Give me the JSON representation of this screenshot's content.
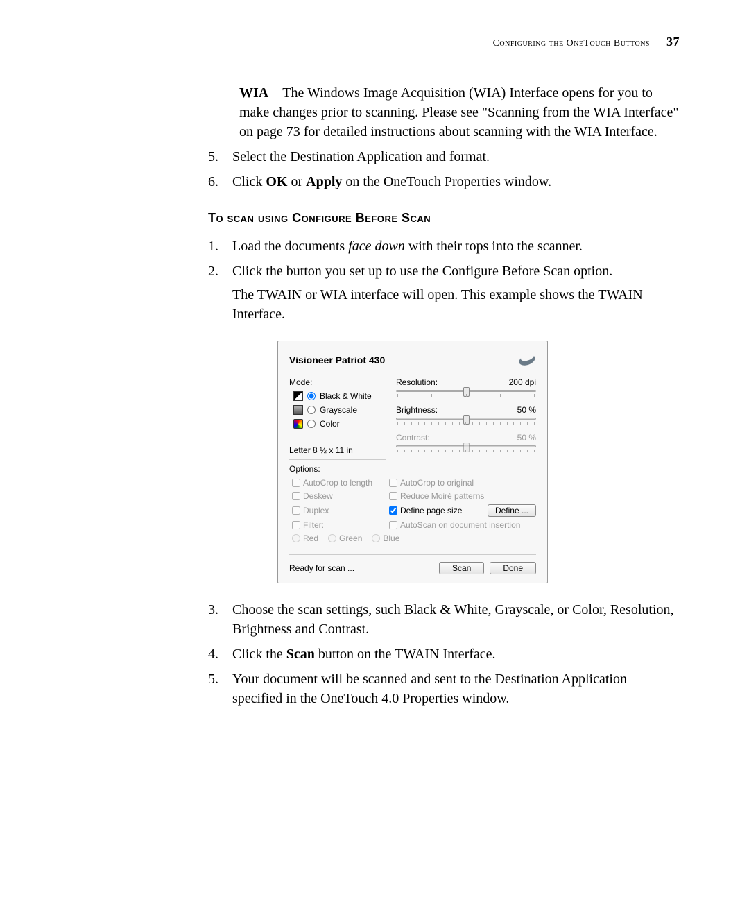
{
  "header": {
    "running_head": "Configuring the OneTouch Buttons",
    "page_number": "37"
  },
  "body": {
    "wia_desc_prefix": "WIA",
    "wia_desc": "—The Windows Image Acquisition (WIA) Interface opens for you to make changes prior to scanning. Please see \"Scanning from the WIA Interface\" on page 73 for detailed instructions about scanning with the WIA Interface.",
    "pre_list": [
      {
        "num": "5.",
        "text": "Select the Destination Application and format."
      },
      {
        "num": "6.",
        "pre": "Click ",
        "b1": "OK",
        "mid": " or ",
        "b2": "Apply",
        "post": " on the OneTouch Properties window."
      }
    ],
    "subheading": "To scan using Configure Before Scan",
    "steps": [
      {
        "num": "1.",
        "pre": "Load the documents ",
        "i": "face down",
        "post": " with their tops into the scanner."
      },
      {
        "num": "2.",
        "text": "Click the button you set up to use the Configure Before Scan option.",
        "sub": "The TWAIN or WIA interface will open. This example shows the TWAIN Interface."
      }
    ],
    "post_steps": [
      {
        "num": "3.",
        "text": "Choose the scan settings, such Black & White, Grayscale, or Color, Resolution, Brightness and Contrast."
      },
      {
        "num": "4.",
        "pre": "Click the ",
        "b1": "Scan",
        "post": " button on the TWAIN Interface."
      },
      {
        "num": "5.",
        "text": "Your document will be scanned and sent to the Destination Application specified in the OneTouch 4.0 Properties window."
      }
    ]
  },
  "dialog": {
    "title": "Visioneer Patriot 430",
    "mode_label": "Mode:",
    "modes": {
      "bw": "Black & White",
      "gray": "Grayscale",
      "color": "Color"
    },
    "page_size": "Letter 8 ½ x 11 in",
    "resolution": {
      "label": "Resolution:",
      "value": "200 dpi",
      "thumb_pct": 48
    },
    "brightness": {
      "label": "Brightness:",
      "value": "50 %",
      "thumb_pct": 48
    },
    "contrast": {
      "label": "Contrast:",
      "value": "50 %",
      "thumb_pct": 48
    },
    "options_label": "Options:",
    "opts": {
      "autocrop_len": "AutoCrop to length",
      "autocrop_orig": "AutoCrop to original",
      "deskew": "Deskew",
      "moire": "Reduce Moiré patterns",
      "duplex": "Duplex",
      "define_page": "Define page size",
      "define_btn": "Define ...",
      "filter": "Filter:",
      "autoscan": "AutoScan on document insertion",
      "red": "Red",
      "green": "Green",
      "blue": "Blue"
    },
    "footer": {
      "status": "Ready for scan ...",
      "scan": "Scan",
      "done": "Done"
    }
  }
}
